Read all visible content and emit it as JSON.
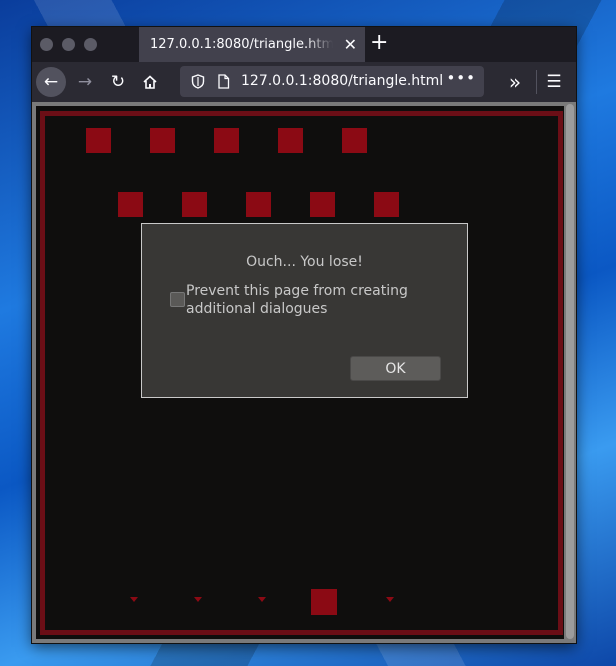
{
  "browser": {
    "tab_title": "127.0.0.1:8080/triangle.html",
    "tab_close": "✕",
    "new_tab": "+",
    "url": "127.0.0.1:8080/triangle.html",
    "url_more": "•••",
    "overflow": "»",
    "menu": "☰",
    "back": "←",
    "forward": "→",
    "reload": "↻"
  },
  "game": {
    "enemy_rows": 2,
    "enemies_per_row": 5,
    "enemy_shots": 4,
    "colors": {
      "enemy": "#8b0a14",
      "border": "#6b0e16",
      "background": "#0f0e0d"
    }
  },
  "dialog": {
    "message": "Ouch... You lose!",
    "checkbox_label": "Prevent this page from creating additional dialogues",
    "checkbox_checked": false,
    "ok_label": "OK"
  }
}
